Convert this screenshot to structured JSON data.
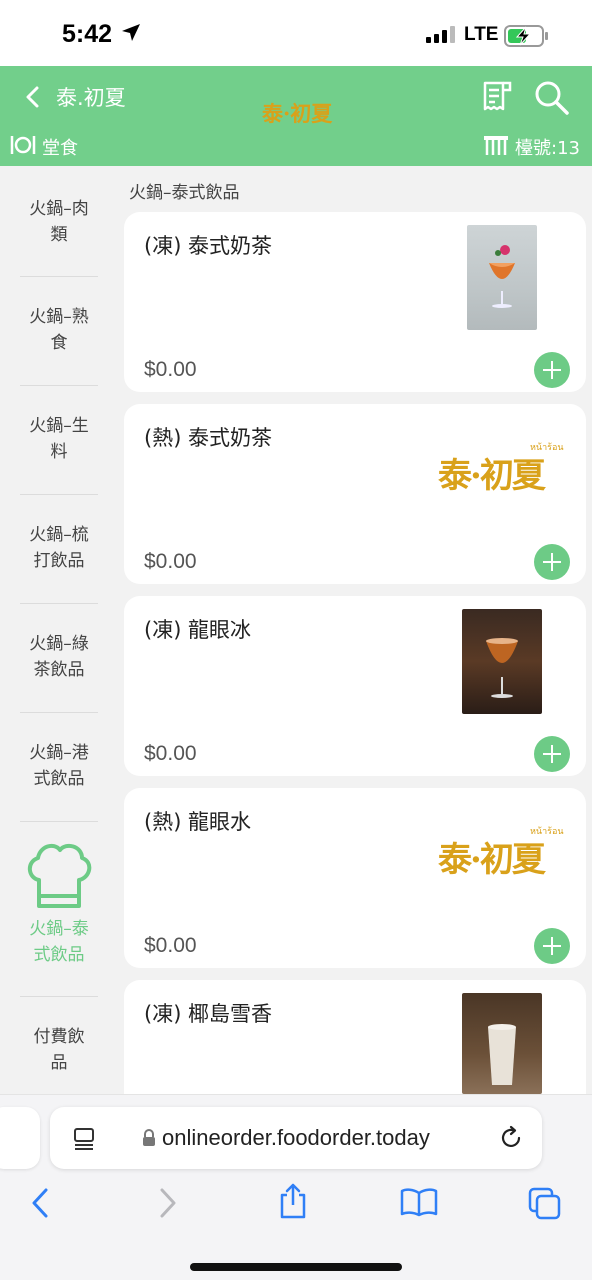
{
  "status_bar": {
    "time": "5:42",
    "network": "LTE"
  },
  "header": {
    "shop_name": "泰.初夏",
    "logo_text": "泰·初夏",
    "logo_tiny": "หน้าร้อน",
    "dine_mode": "堂食",
    "table_label": "檯號:13",
    "colors": {
      "brand_green": "#72cf8b",
      "logo_gold": "#d9a11a"
    }
  },
  "sidebar": {
    "categories": [
      {
        "label_line1": "火鍋–肉",
        "label_line2": "類"
      },
      {
        "label_line1": "火鍋–熟",
        "label_line2": "食"
      },
      {
        "label_line1": "火鍋–生",
        "label_line2": "料"
      },
      {
        "label_line1": "火鍋–梳",
        "label_line2": "打飲品"
      },
      {
        "label_line1": "火鍋–綠",
        "label_line2": "茶飲品"
      },
      {
        "label_line1": "火鍋–港",
        "label_line2": "式飲品"
      },
      {
        "label_line1": "火鍋–泰",
        "label_line2": "式飲品",
        "active": true,
        "icon": "chef-hat-icon"
      },
      {
        "label_line1": "付費飲",
        "label_line2": "品"
      }
    ]
  },
  "main": {
    "section_title": "火鍋–泰式飲品",
    "items": [
      {
        "name": "(凍) 泰式奶茶",
        "price": "$0.00",
        "image": "photo"
      },
      {
        "name": "(熱) 泰式奶茶",
        "price": "$0.00",
        "image": "logo"
      },
      {
        "name": "(凍) 龍眼冰",
        "price": "$0.00",
        "image": "photo"
      },
      {
        "name": "(熱) 龍眼水",
        "price": "$0.00",
        "image": "logo"
      },
      {
        "name": "(凍) 椰島雪香",
        "price": "",
        "image": "photo"
      }
    ]
  },
  "browser": {
    "url": "onlineorder.foodorder.today"
  }
}
